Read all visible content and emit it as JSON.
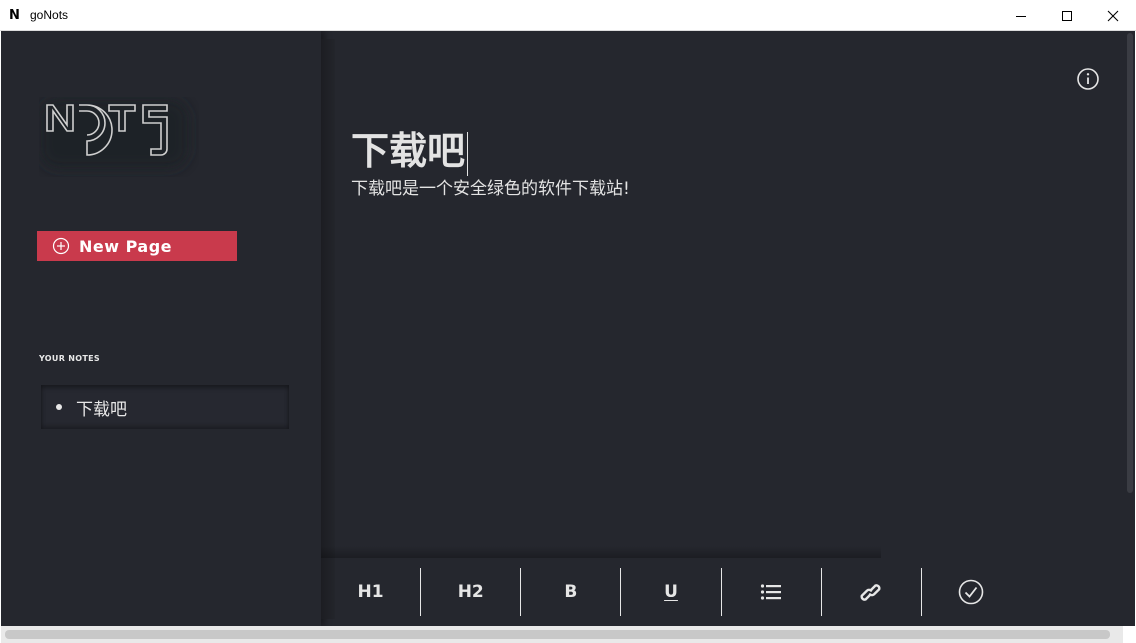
{
  "window": {
    "app_logo": "N",
    "title": "goNots",
    "minimize_icon": "minimize-icon",
    "maximize_icon": "maximize-icon",
    "close_icon": "close-icon"
  },
  "sidebar": {
    "brand_logo_text": "NOTS",
    "new_page_label": "New Page",
    "notes_heading": "YOUR NOTES",
    "notes": [
      {
        "label": "下载吧"
      }
    ]
  },
  "editor": {
    "title": "下载吧",
    "body": "下载吧是一个安全绿色的软件下载站!",
    "info_icon": "info-icon"
  },
  "toolbar": {
    "h1_label": "H1",
    "h2_label": "H2",
    "bold_label": "B",
    "underline_label": "U",
    "list_icon": "list-icon",
    "link_icon": "link-icon",
    "save_icon": "check-circle-icon"
  },
  "colors": {
    "background": "#25272e",
    "accent": "#c93a4c",
    "text": "#e3e3e3"
  }
}
